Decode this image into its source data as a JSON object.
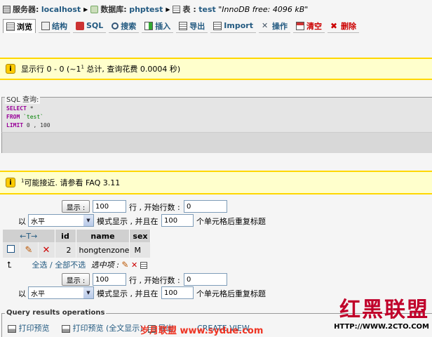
{
  "breadcrumb": {
    "server_label": "服务器:",
    "server": "localhost",
    "db_label": "数据库:",
    "db": "phptest",
    "table_label": "表 :",
    "table": "test",
    "engine_info": "\"InnoDB free: 4096 kB\""
  },
  "tabs": [
    {
      "label": "浏览",
      "icon": "browse-icon"
    },
    {
      "label": "结构",
      "icon": "structure-icon"
    },
    {
      "label": "SQL",
      "icon": "sql-icon"
    },
    {
      "label": "搜索",
      "icon": "search-icon"
    },
    {
      "label": "插入",
      "icon": "insert-icon"
    },
    {
      "label": "导出",
      "icon": "export-icon"
    },
    {
      "label": "Import",
      "icon": "import-icon"
    },
    {
      "label": "操作",
      "icon": "operations-icon"
    },
    {
      "label": "清空",
      "icon": "empty-icon"
    },
    {
      "label": "删除",
      "icon": "drop-icon"
    }
  ],
  "notice1": {
    "pre": "显示行 0 - 0 (~1",
    "sup": "1",
    "post": " 总计, 查询花费 0.0004 秒)"
  },
  "sql_box": {
    "legend": "SQL 查询:",
    "select_kw": "SELECT",
    "select_val": " *",
    "from_kw": "FROM",
    "from_val": " `test`",
    "limit_kw": "LIMIT",
    "limit_val": " 0 , 100"
  },
  "notice2": {
    "sup": "1",
    "text": "可能接近. 请参看 FAQ 3.11"
  },
  "nav": {
    "show_button": "显示 :",
    "rows_value": "100",
    "rows_suffix": "行 , 开始行数 :",
    "start_value": "0",
    "mode_prefix": "以",
    "mode_selected": "水平",
    "mode_suffix": "模式显示 , 并且在",
    "repeat_value": "100",
    "repeat_suffix": "个单元格后重复标题"
  },
  "table": {
    "arrows": "←T→",
    "headers": [
      "id",
      "name",
      "sex"
    ],
    "row": {
      "id": "2",
      "name": "hongtenzone",
      "sex": "M"
    }
  },
  "bulk": {
    "select_all": "全选",
    "sep": " / ",
    "select_none": "全部不选",
    "with_selected": "选中项 :"
  },
  "query_ops": {
    "legend": "Query results operations",
    "print": "打印预览",
    "print_full": "打印预览 (全文显示)",
    "export": "导出",
    "create_view": "CREATE VIEW"
  },
  "watermark": {
    "big": "红黑联盟",
    "url": "HTTP://WWW.2CTO.COM",
    "mid": "岁月联盟 www.sydue.com"
  },
  "colors": {
    "link": "#235a81",
    "notice_bg": "#ffffcc",
    "notice_border": "#ffd700",
    "watermark": "#c0002a"
  }
}
